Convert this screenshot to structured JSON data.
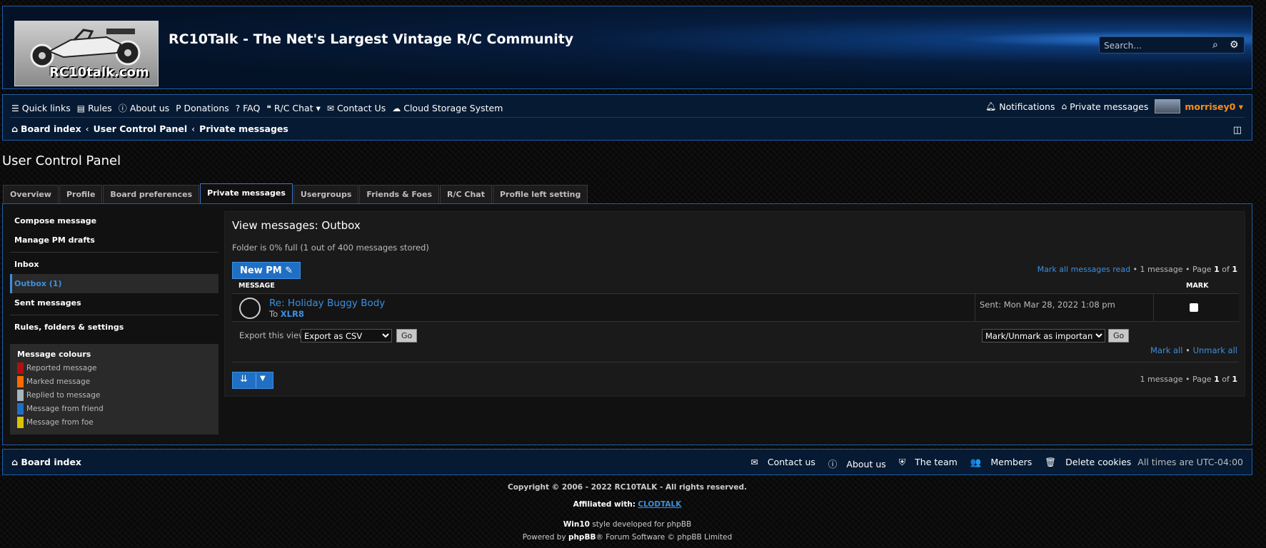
{
  "header": {
    "site_title": "RC10Talk - The Net's Largest Vintage R/C Community",
    "logo_text": "RC10talk.com",
    "search_placeholder": "Search…"
  },
  "nav": {
    "items": [
      {
        "icon": "☰",
        "label": "Quick links"
      },
      {
        "icon": "▤",
        "label": "Rules"
      },
      {
        "icon": "ⓘ",
        "label": "About us"
      },
      {
        "icon": "P",
        "label": "Donations"
      },
      {
        "icon": "?",
        "label": "FAQ"
      },
      {
        "icon": "❝",
        "label": "R/C Chat ▾"
      },
      {
        "icon": "✉",
        "label": "Contact Us"
      },
      {
        "icon": "☁",
        "label": "Cloud Storage System"
      }
    ],
    "notifications": "Notifications",
    "private_messages": "Private messages",
    "username": "morrisey0 ▾",
    "breadcrumbs": [
      "Board index",
      "User Control Panel",
      "Private messages"
    ]
  },
  "page": {
    "title": "User Control Panel",
    "tabs": [
      "Overview",
      "Profile",
      "Board preferences",
      "Private messages",
      "Usergroups",
      "Friends & Foes",
      "R/C Chat",
      "Profile left setting"
    ]
  },
  "sidebar": {
    "compose": "Compose message",
    "drafts": "Manage PM drafts",
    "inbox": "Inbox",
    "outbox": "Outbox (1)",
    "sent": "Sent messages",
    "rules": "Rules, folders & settings",
    "colours_title": "Message colours",
    "colours": [
      {
        "label": "Reported message",
        "color": "#b01010"
      },
      {
        "label": "Marked message",
        "color": "#ff6a00"
      },
      {
        "label": "Replied to message",
        "color": "#a8b4c0"
      },
      {
        "label": "Message from friend",
        "color": "#1e6fc8"
      },
      {
        "label": "Message from foe",
        "color": "#d8c400"
      }
    ]
  },
  "content": {
    "title": "View messages: Outbox",
    "folder_info": "Folder is 0% full (1 out of 400 messages stored)",
    "new_pm": "New PM ✎",
    "mark_all_read": "Mark all messages read",
    "pagination_prefix": "• 1 message • Page",
    "page_current": "1",
    "page_of": "of",
    "page_total": "1",
    "col_message": "MESSAGE",
    "col_mark": "MARK",
    "message": {
      "subject": "Re: Holiday Buggy Body",
      "to_label": "To",
      "to_user": "XLR8",
      "sent": "Sent: Mon Mar 28, 2022 1:08 pm"
    },
    "export_label": "Export this view:",
    "export_option": "Export as CSV",
    "go": "Go",
    "mark_action": "Mark/Unmark as important",
    "mark_all": "Mark all",
    "bullet": "•",
    "unmark_all": "Unmark all",
    "pagination_bottom_prefix": "1 message • Page"
  },
  "footer": {
    "board_index": "Board index",
    "links": [
      {
        "icon": "✉",
        "label": "Contact us"
      },
      {
        "icon": "ⓘ",
        "label": "About us"
      },
      {
        "icon": "⛨",
        "label": "The team"
      },
      {
        "icon": "👥",
        "label": "Members"
      },
      {
        "icon": "🗑",
        "label": "Delete cookies"
      }
    ],
    "timezone": "All times are UTC-04:00",
    "copyright": "Copyright © 2006 - 2022 RC10TALK - All rights reserved.",
    "affiliated_label": "Affiliated with:",
    "affiliated_link": "CLODTALK",
    "style_name": "Win10",
    "style_rest": "style developed for phpBB",
    "powered_prefix": "Powered by",
    "powered_name": "phpBB",
    "powered_rest": "® Forum Software © phpBB Limited"
  }
}
